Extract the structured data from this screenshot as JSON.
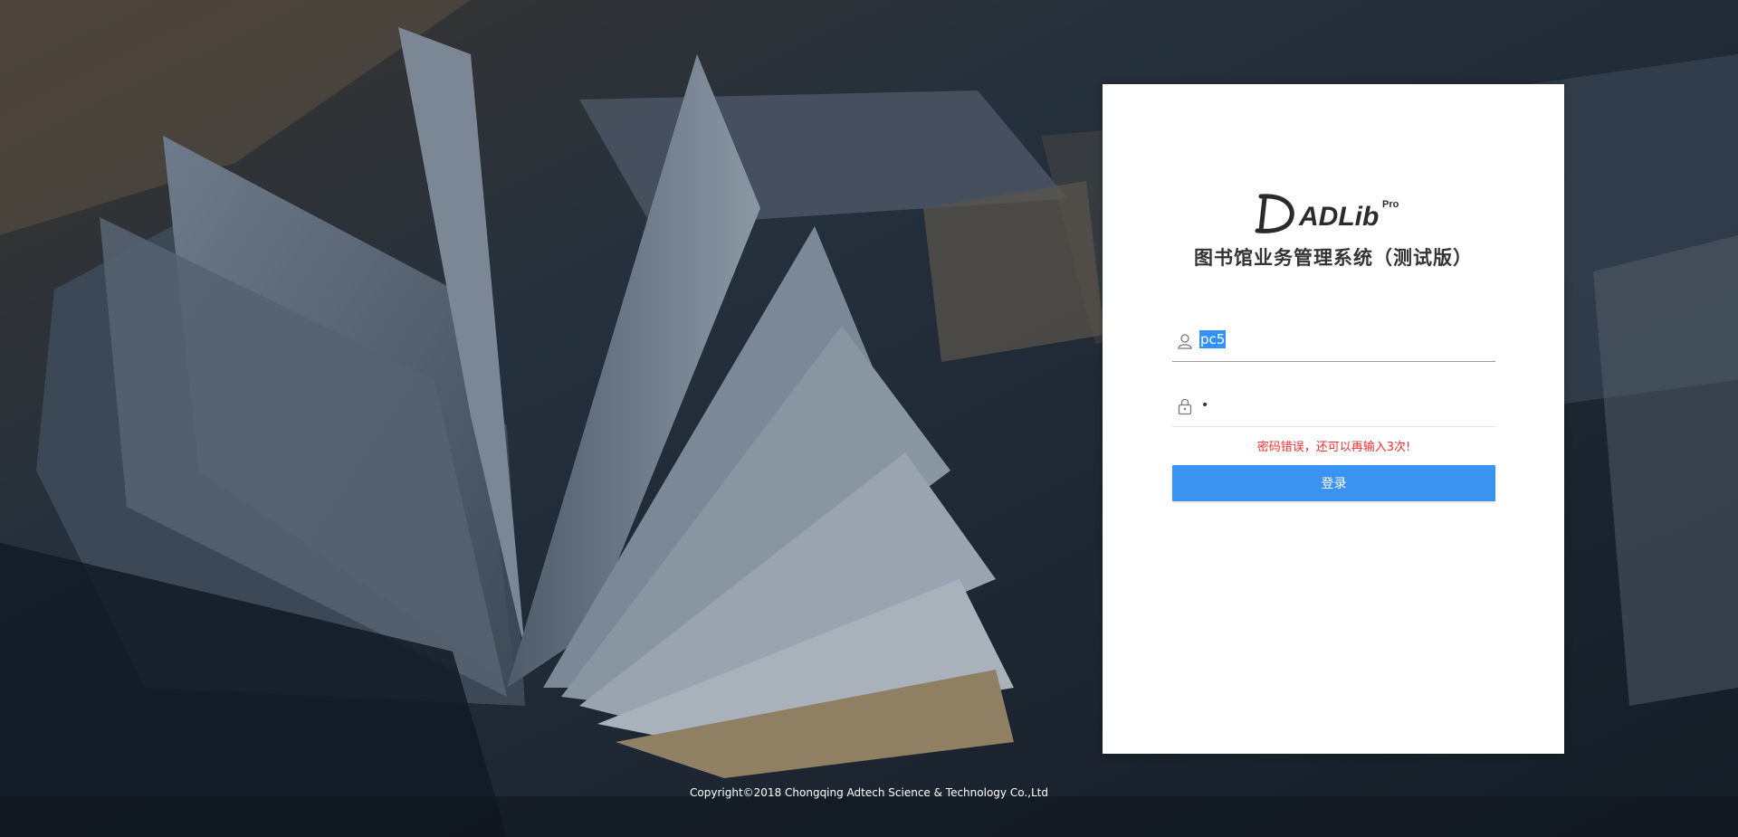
{
  "login": {
    "logo_text": "ADLib",
    "logo_badge": "Pro",
    "system_title": "图书馆业务管理系统（测试版）",
    "username_value": "pc5",
    "password_mask": "•",
    "error_message": "密码错误，还可以再输入3次!",
    "login_button": "登录"
  },
  "icons": {
    "username": "user-icon",
    "password": "lock-icon"
  },
  "colors": {
    "accent": "#3a93f1",
    "error": "#f23030",
    "selection": "#3390ff"
  },
  "footer": {
    "copyright": "Copyright©2018 Chongqing Adtech Science & Technology Co.,Ltd"
  }
}
